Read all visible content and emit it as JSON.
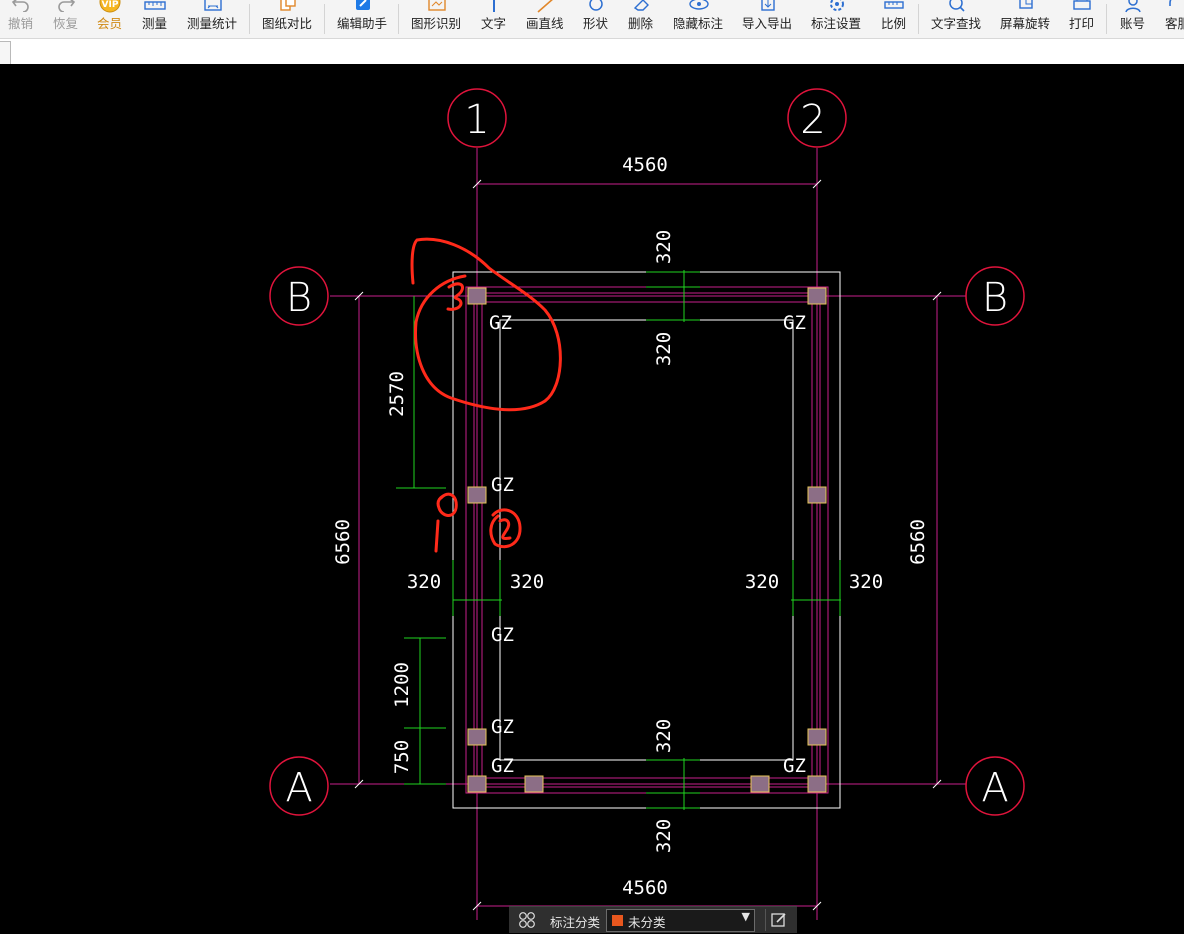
{
  "toolbar": {
    "items": [
      {
        "label": "撤销",
        "icon": "undo-icon",
        "state": "disabled"
      },
      {
        "label": "恢复",
        "icon": "redo-icon",
        "state": "disabled"
      },
      {
        "label": "会员",
        "icon": "vip-icon",
        "state": "vip"
      },
      {
        "label": "测量",
        "icon": "ruler-icon",
        "state": "normal"
      },
      {
        "label": "测量统计",
        "icon": "measure-stats-icon",
        "state": "normal"
      },
      {
        "label": "图纸对比",
        "icon": "compare-icon",
        "state": "normal"
      },
      {
        "label": "编辑助手",
        "icon": "edit-assistant-icon",
        "state": "normal"
      },
      {
        "label": "图形识别",
        "icon": "shape-recognize-icon",
        "state": "normal"
      },
      {
        "label": "文字",
        "icon": "text-icon",
        "state": "normal"
      },
      {
        "label": "画直线",
        "icon": "line-icon",
        "state": "normal"
      },
      {
        "label": "形状",
        "icon": "shape-icon",
        "state": "normal"
      },
      {
        "label": "删除",
        "icon": "eraser-icon",
        "state": "normal"
      },
      {
        "label": "隐藏标注",
        "icon": "eye-icon",
        "state": "normal"
      },
      {
        "label": "导入导出",
        "icon": "import-export-icon",
        "state": "normal"
      },
      {
        "label": "标注设置",
        "icon": "settings-icon",
        "state": "normal"
      },
      {
        "label": "比例",
        "icon": "scale-icon",
        "state": "normal"
      },
      {
        "label": "文字查找",
        "icon": "text-search-icon",
        "state": "normal"
      },
      {
        "label": "屏幕旋转",
        "icon": "rotate-icon",
        "state": "normal"
      },
      {
        "label": "打印",
        "icon": "printer-icon",
        "state": "normal"
      },
      {
        "label": "账号",
        "icon": "user-icon",
        "state": "normal"
      },
      {
        "label": "客服",
        "icon": "headset-icon",
        "state": "normal"
      }
    ]
  },
  "drawing": {
    "axis_labels": {
      "col1": "1",
      "col2": "2",
      "rowB": "B",
      "rowA": "A"
    },
    "dims": {
      "top_span": "4560",
      "bottom_span": "4560",
      "left_total": "6560",
      "right_total": "6560",
      "upper_wall_outer": "320",
      "upper_wall_inner": "320",
      "lower_wall_outer": "320",
      "lower_wall_inner": "320",
      "left_wall_outer": "320",
      "left_wall_inner": "320",
      "right_wall_inner": "320",
      "right_wall_outer": "320",
      "seg_2570": "2570",
      "seg_1200": "1200",
      "seg_750": "750"
    },
    "gz_labels": [
      "GZ",
      "GZ",
      "GZ",
      "GZ",
      "GZ",
      "GZ",
      "GZ"
    ]
  },
  "annotation_bar": {
    "label": "标注分类",
    "selected": "未分类",
    "swatch_color": "#e8571e"
  },
  "colors": {
    "cad_bg": "#000000",
    "axis_line": "#c8208c",
    "bubble": "#e0143c",
    "dim": "#1fd51f",
    "hand_mark": "#ff2a1a",
    "column": "#8c6e86"
  }
}
